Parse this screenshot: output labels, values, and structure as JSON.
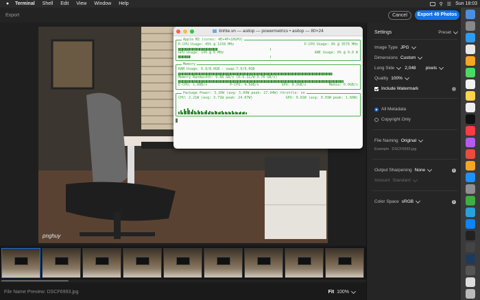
{
  "menubar": {
    "app": "Terminal",
    "items": [
      "Shell",
      "Edit",
      "View",
      "Window",
      "Help"
    ],
    "clock": "Sun 18:03"
  },
  "window": {
    "title": "Export",
    "cancel_label": "Cancel",
    "export_label": "Export 49 Photos"
  },
  "photo": {
    "watermark": "pnghuy"
  },
  "terminal": {
    "title": "tinhte.vn — asitop — powermetrics • asitop — 80×24",
    "chip_legend": "Apple M2 (cores: 4E+4P+10GPU)",
    "ecpu": "E-CPU Usage: 45% @ 1156 MHz",
    "pcpu": "P-CPU Usage: 0% @ 3579 MHz",
    "gpu": "GPU Usage: 14% @ 0 MHz",
    "ane": "ANE Usage: 0% @ 0.0 W",
    "memory_legend": "Memory",
    "ram": "RAM Usage: 6.9/8.0GB - swap:7.9/9.0GB",
    "bandwidth": "Memory Bandwidth: 9.88 GB/s (R:6.32/W:3.76 GB/s)",
    "bw_ecpu": "E-CPU: 1.60B/s",
    "bw_pcpu": "P-CPU: 4.5GB/s",
    "bw_gpu": "GPU: 0.3GB/s",
    "bw_media": "Media: 0.0GB/s",
    "power_legend": "Package Power: 3.20W (avg: 5.09W peak: 27.94W) throttle: no",
    "cpu_power": "CPU: 2.21W (avg: 3.71W peak: 24.07W)",
    "gpu_power": "GPU: 0.02W (avg: 0.03W peak: 1.60W)",
    "ecpu_frac": 0.45,
    "pcpu_frac": 0.0,
    "gpu_frac": 0.14,
    "ane_frac": 0.0,
    "ram_frac": 0.86,
    "bw_frac": 0.92
  },
  "filmstrip": {
    "count": 9
  },
  "bottombar": {
    "filename": "File Name Preview: DSCF6993.jpg",
    "fit_label": "Fit",
    "zoom": "100%"
  },
  "panel": {
    "settings_label": "Settings",
    "preset_label": "Preset",
    "image_type_label": "Image Type",
    "image_type_value": "JPG",
    "dimensions_label": "Dimensions",
    "dimensions_value": "Custom",
    "long_side_label": "Long Side",
    "long_side_value": "2,048",
    "long_side_unit": "pixels",
    "quality_label": "Quality",
    "quality_value": "100%",
    "include_watermark": "Include Watermark",
    "all_metadata": "All Metadata",
    "copyright_only": "Copyright Only",
    "file_naming_label": "File Naming",
    "file_naming_value": "Original",
    "example_label": "Example",
    "example_value": "DSCF6993.jpg",
    "sharpening_label": "Output Sharpening",
    "sharpening_value": "None",
    "amount_label": "Amount",
    "amount_value": "Standard",
    "color_space_label": "Color Space",
    "color_space_value": "sRGB"
  },
  "colors": {
    "accent": "#1473e6",
    "terminal_green": "#3aa83a"
  }
}
